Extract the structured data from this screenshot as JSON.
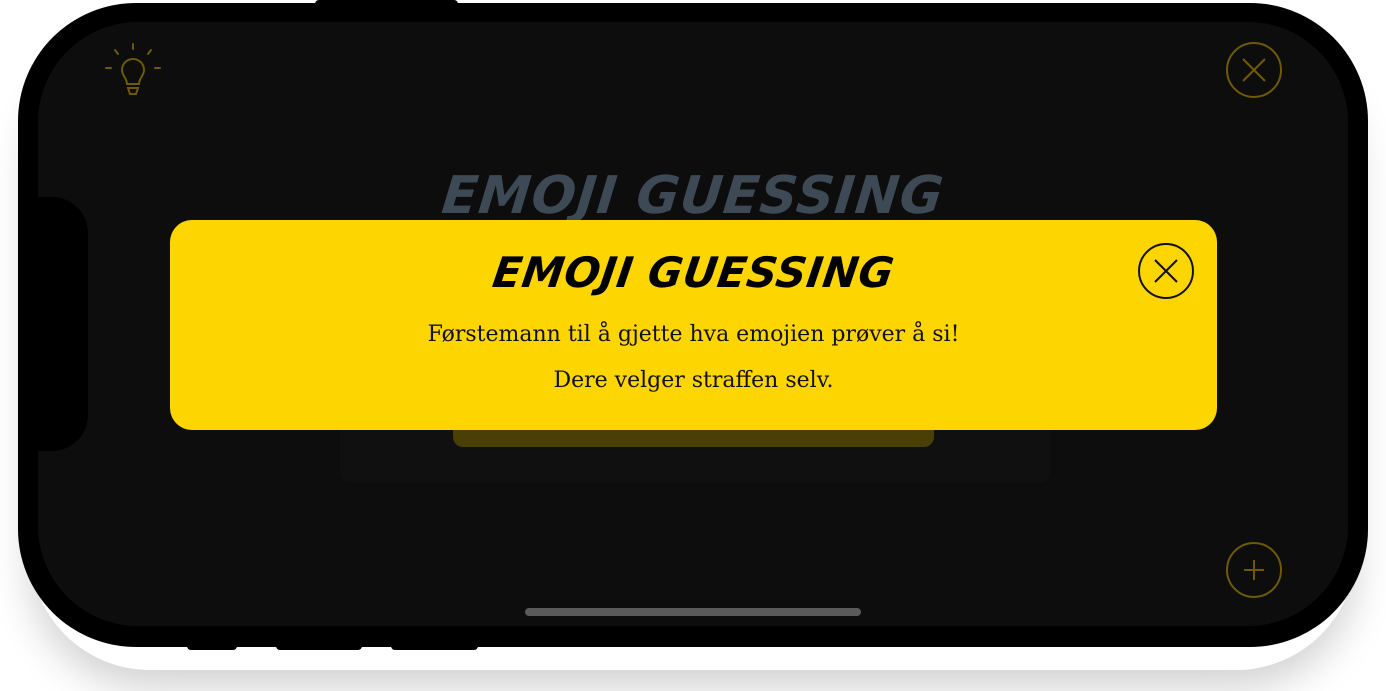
{
  "app": {
    "background_title": "EMOJI GUESSING"
  },
  "modal": {
    "title": "EMOJI GUESSING",
    "line1": "Førstemann til å gjette hva emojien prøver å si!",
    "line2": "Dere velger straffen selv."
  },
  "icons": {
    "hint": "lightbulb-icon",
    "close_top": "close-icon",
    "add": "plus-icon",
    "modal_close": "close-icon"
  },
  "colors": {
    "accent": "#fdd500",
    "screen_bg": "#0d0d0d",
    "dim_accent": "#6e5a05"
  }
}
